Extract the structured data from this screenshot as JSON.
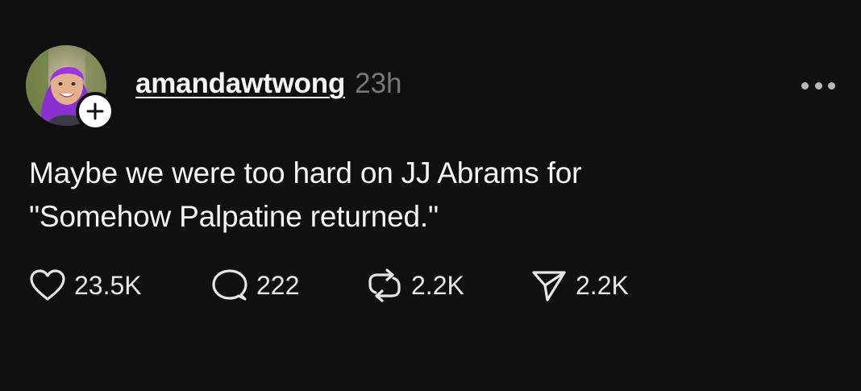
{
  "post": {
    "author": {
      "username": "amandawtwong",
      "avatar_icon": "profile-photo",
      "follow_badge_icon": "plus-icon"
    },
    "timestamp": "23h",
    "more_icon": "ellipsis-icon",
    "text_lines": [
      "Maybe we were too hard on JJ Abrams for",
      "\"Somehow Palpatine returned.\""
    ],
    "actions": {
      "like": {
        "icon": "heart-icon",
        "count": "23.5K"
      },
      "reply": {
        "icon": "comment-bubble-icon",
        "count": "222"
      },
      "repost": {
        "icon": "repost-icon",
        "count": "2.2K"
      },
      "share": {
        "icon": "send-icon",
        "count": "2.2K"
      }
    }
  },
  "colors": {
    "background": "#101010",
    "primary_text": "#f3f5f7",
    "secondary_text": "#777777"
  }
}
